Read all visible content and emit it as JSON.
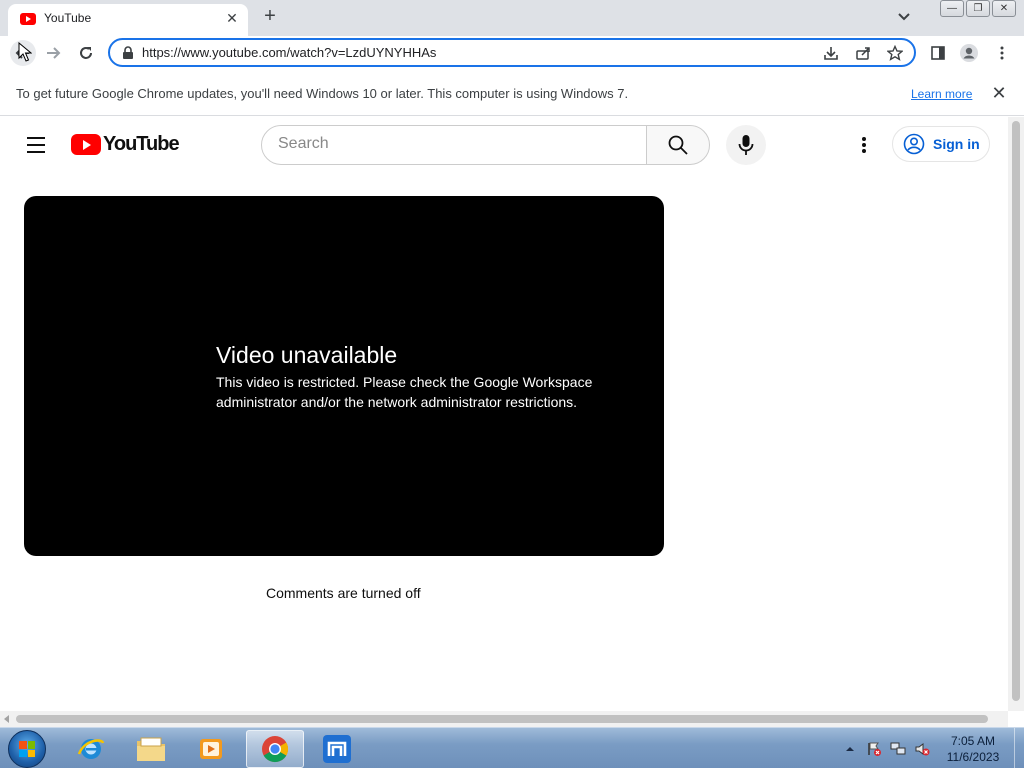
{
  "browser": {
    "tab": {
      "title": "YouTube",
      "close_label": "✕"
    },
    "new_tab_label": "+",
    "window_buttons": [
      "—",
      "❐",
      "✕"
    ],
    "url": "https://www.youtube.com/watch?v=LzdUYNYHHAs",
    "infobar": {
      "message": "To get future Google Chrome updates, you'll need Windows 10 or later. This computer is using Windows 7.",
      "link": "Learn more",
      "close_label": "✕"
    }
  },
  "youtube": {
    "logo_text": "YouTube",
    "search_placeholder": "Search",
    "signin_label": "Sign in",
    "error_title": "Video unavailable",
    "error_message": "This video is restricted. Please check the Google Workspace administrator and/or the network administrator restrictions.",
    "comments_status": "Comments are turned off"
  },
  "taskbar": {
    "apps": [
      "internet-explorer-icon",
      "file-explorer-icon",
      "media-player-icon",
      "chrome-icon",
      "maxthon-icon"
    ],
    "clock_time": "7:05 AM",
    "clock_date": "11/6/2023"
  },
  "colors": {
    "youtube_red": "#ff0000",
    "accent_blue": "#1a73e8",
    "signin_blue": "#065fd4",
    "player_bg": "#000000"
  }
}
